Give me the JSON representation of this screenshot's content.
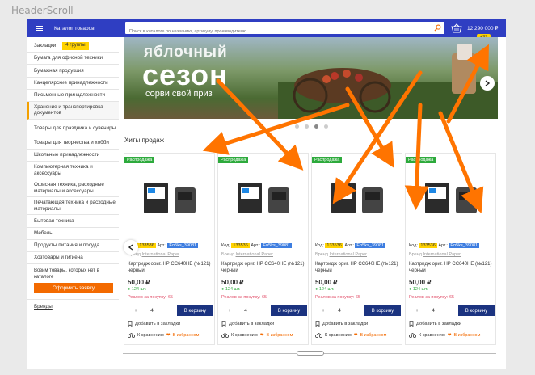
{
  "window": {
    "title": "HeaderScroll"
  },
  "header": {
    "catalog_label": "Каталог товаров",
    "search_placeholder": "Поиск в каталоге по названию, артикулу, производителю",
    "cart_total": "12 290 000 ₽",
    "cart_badge": "+99"
  },
  "sidebar": {
    "bookmarks_label": "Закладки",
    "bookmarks_badge": "4 группы",
    "items": [
      "Бумага для офисной техники",
      "Бумажная продукция",
      "Канцелярские принадлежности",
      "Письменные принадлежности",
      "Хранение и транспортировка документов",
      "Товары для праздника и сувениры",
      "Товары для творчества и хобби",
      "Школьные принадлежности",
      "Компьютерная техника и аксессуары",
      "Офисная техника, расходные материалы и аксессуары",
      "Печатающая техника и расходные материалы",
      "Бытовая техника",
      "Мебель",
      "Продукты питания и посуда",
      "Хозтовары и гигиена"
    ],
    "missing_text": "Возим товары, которых нет в каталоге",
    "order_button": "Оформить заявку",
    "brands_link": "Бренды"
  },
  "banner": {
    "line1": "яблочный",
    "line2": "сезон",
    "line3": "сорви свой приз"
  },
  "section": {
    "title": "Хиты продаж"
  },
  "product": {
    "sale_label": "Распродажа",
    "code_label": "Код:",
    "code_value": "133536",
    "art_label": "Арт.:",
    "art_value": "En5ks_39081",
    "brand_label": "Бренд",
    "brand_value": "International Paper",
    "name": "Картридж ориг. HP CC640HE (№121) черный",
    "price": "50,00 ₽",
    "stock": "● 124 шт.",
    "bonus": "Реалов за покупку: 65",
    "qty_minus": "−",
    "qty_value": "4",
    "qty_plus": "+",
    "cart_button": "В корзину",
    "bookmark_label": "Добавить в закладки",
    "compare_label": "К сравнению",
    "favorite_label": "В избранном"
  },
  "colors": {
    "header": "#2f3ec2",
    "accent_orange": "#f36a00",
    "sale_green": "#2daa3c",
    "cart_button": "#1b3380",
    "badge_yellow": "#ffd200"
  }
}
